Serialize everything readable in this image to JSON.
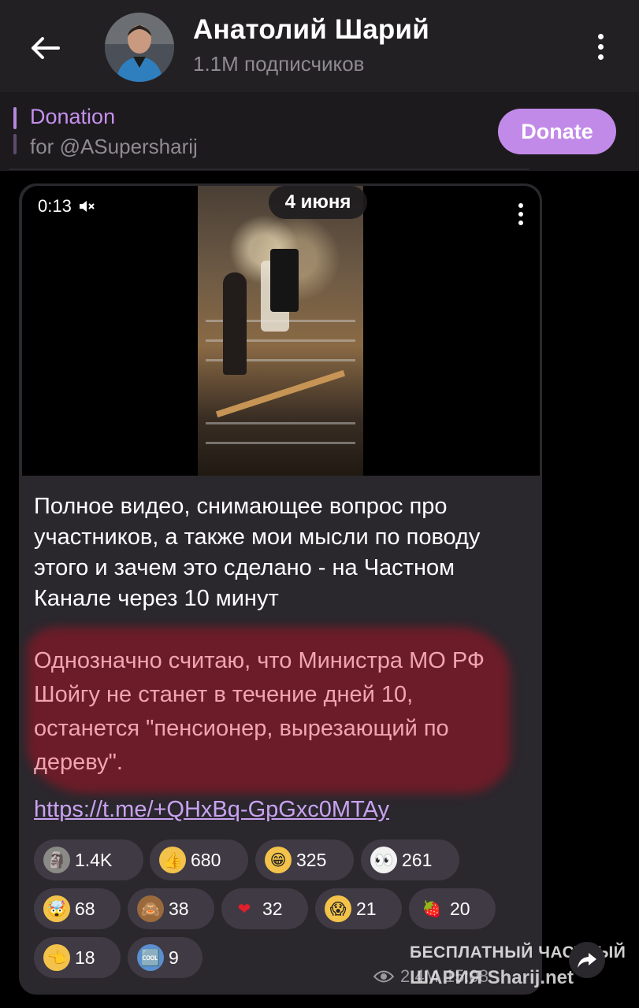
{
  "header": {
    "channel_name": "Анатолий Шарий",
    "subscribers": "1.1M подписчиков"
  },
  "pinned": {
    "title": "Donation",
    "subtitle": "for @ASupersharij",
    "button_label": "Donate"
  },
  "video": {
    "duration": "0:13",
    "date_label": "4 июня"
  },
  "message": {
    "text": "Полное видео, снимающее вопрос про участников, а также мои мысли по поводу этого и зачем это сделано - на Частном Канале через 10 минут",
    "highlighted_text": "Однозначно считаю, что Министра МО РФ Шойгу не станет в течение дней 10, останется \"пенсионер, вырезающий по дереву\".",
    "link": "https://t.me/+QHxBq-GpGxc0MTAy"
  },
  "reactions": [
    {
      "icon": "moai-icon",
      "glyph": "🗿",
      "count": "1.4K"
    },
    {
      "icon": "thumbs-up-icon",
      "glyph": "👍",
      "count": "680"
    },
    {
      "icon": "grin-icon",
      "glyph": "😁",
      "count": "325"
    },
    {
      "icon": "eyes-icon",
      "glyph": "👀",
      "count": "261"
    },
    {
      "icon": "exploding-head-icon",
      "glyph": "🤯",
      "count": "68"
    },
    {
      "icon": "see-no-evil-icon",
      "glyph": "🙈",
      "count": "38"
    },
    {
      "icon": "heart-icon",
      "glyph": "❤",
      "count": "32"
    },
    {
      "icon": "scream-icon",
      "glyph": "😱",
      "count": "21"
    },
    {
      "icon": "strawberry-icon",
      "glyph": "🍓",
      "count": "20"
    },
    {
      "icon": "pointing-hand-icon",
      "glyph": "👈",
      "count": "18"
    },
    {
      "icon": "cool-icon",
      "glyph": "🆒",
      "count": "9"
    }
  ],
  "footer": {
    "views": "2.4M",
    "time": "15:08",
    "watermark_line1": "БЕСПЛАТНЫЙ ЧАСТНЫЙ",
    "watermark_line2": "ШАРИЯ Sharij.net"
  }
}
